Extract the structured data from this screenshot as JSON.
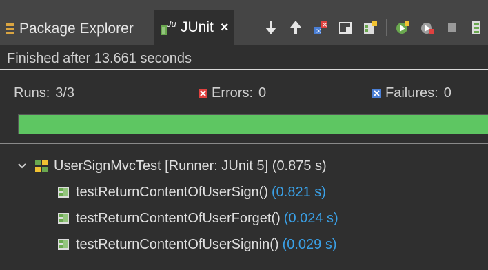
{
  "tabs": {
    "package_explorer": "Package Explorer",
    "junit": "JUnit",
    "close_glyph": "×"
  },
  "toolbar": {
    "icons": [
      "next-failure-icon",
      "previous-failure-icon",
      "show-failures-only-icon",
      "scroll-lock-icon",
      "show-skipped-icon",
      "rerun-test-icon",
      "rerun-failed-first-icon",
      "stop-icon",
      "test-run-history-icon"
    ]
  },
  "status": {
    "finished": "Finished after 13.661 seconds"
  },
  "counters": {
    "runs_label": "Runs:",
    "runs_value": "3/3",
    "errors_label": "Errors:",
    "errors_value": "0",
    "failures_label": "Failures:",
    "failures_value": "0"
  },
  "progress": {
    "fraction": 1.0,
    "color": "#5ec662"
  },
  "tree": {
    "root": {
      "label": "UserSignMvcTest [Runner: JUnit 5] (0.875 s)"
    },
    "children": [
      {
        "label": "testReturnContentOfUserSign()",
        "time": "(0.821 s)"
      },
      {
        "label": "testReturnContentOfUserForget()",
        "time": "(0.024 s)"
      },
      {
        "label": "testReturnContentOfUserSignin()",
        "time": "(0.029 s)"
      }
    ]
  },
  "colors": {
    "background": "#2f2f2f",
    "tabbar": "#454545",
    "time_accent": "#3aa0e6",
    "error_red": "#e0413f",
    "failure_blue": "#4a7fd6"
  }
}
